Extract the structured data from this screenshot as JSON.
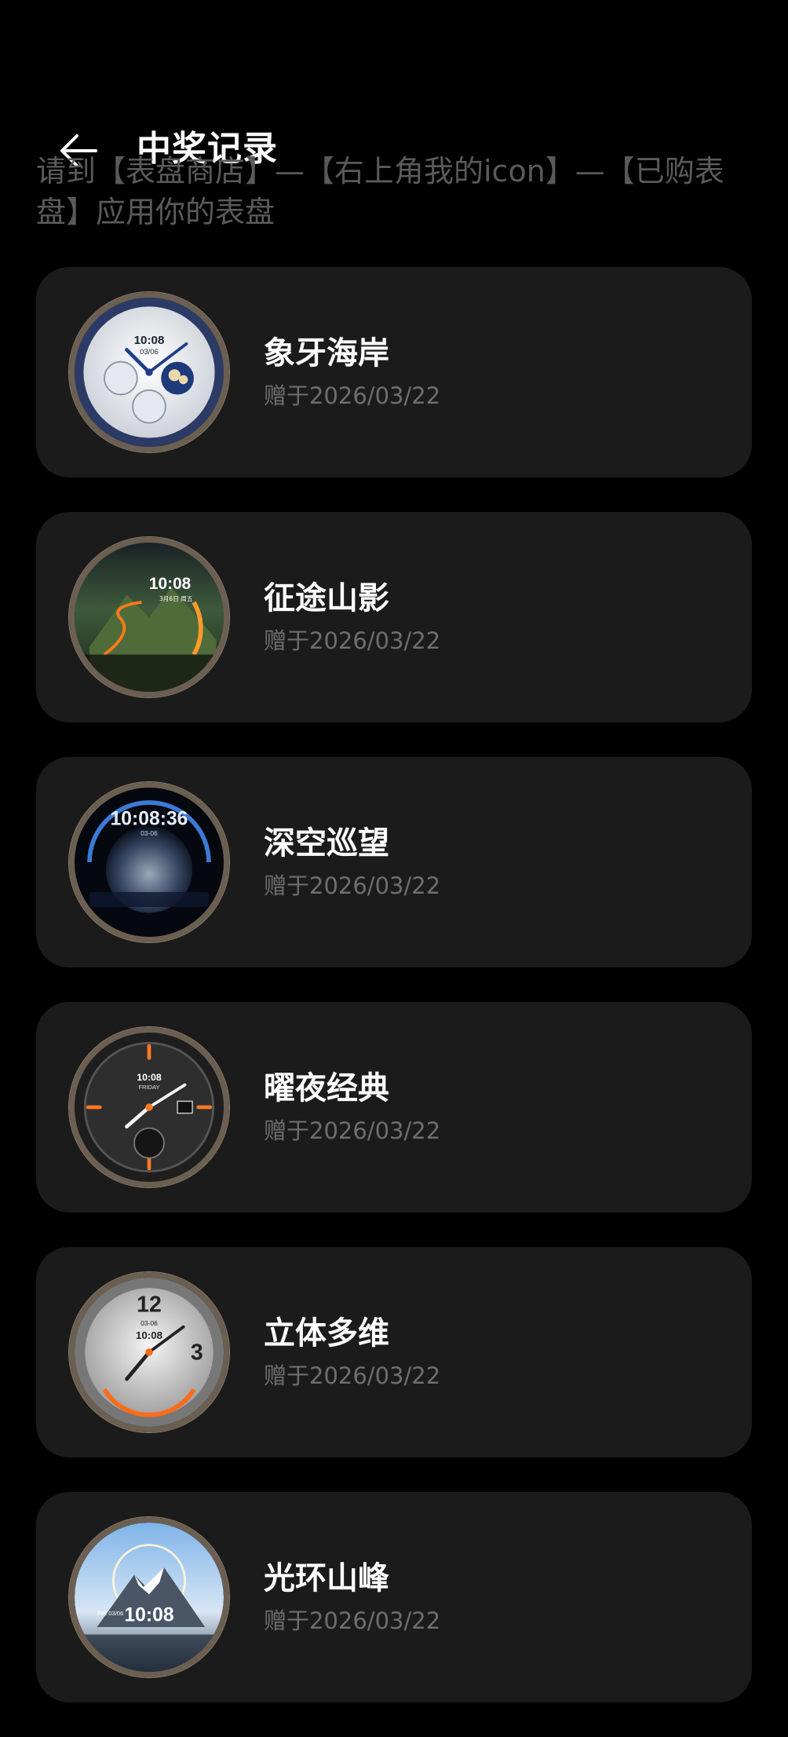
{
  "header": {
    "title": "中奖记录",
    "back_icon": "arrow-left-icon"
  },
  "hint": "请到【表盘商店】—【右上角我的icon】—【已购表盘】应用你的表盘",
  "records": [
    {
      "name": "象牙海岸",
      "date": "赠于2026/03/22",
      "face_time": "10:08",
      "face_date": "03/06"
    },
    {
      "name": "征途山影",
      "date": "赠于2026/03/22",
      "face_time": "10:08",
      "face_date": "3月6日 周五"
    },
    {
      "name": "深空巡望",
      "date": "赠于2026/03/22",
      "face_time": "10:08:36",
      "face_date": "03-06"
    },
    {
      "name": "曜夜经典",
      "date": "赠于2026/03/22",
      "face_time": "10:08",
      "face_date": "FRIDAY"
    },
    {
      "name": "立体多维",
      "date": "赠于2026/03/22",
      "face_time": "10:08",
      "face_date": "03-06"
    },
    {
      "name": "光环山峰",
      "date": "赠于2026/03/22",
      "face_time": "10:08",
      "face_date": "FRI 03/06"
    }
  ],
  "colors": {
    "background": "#000000",
    "card": "#1b1b1b",
    "hint_text": "#5a5a5a",
    "date_text": "#6e6e6e"
  }
}
